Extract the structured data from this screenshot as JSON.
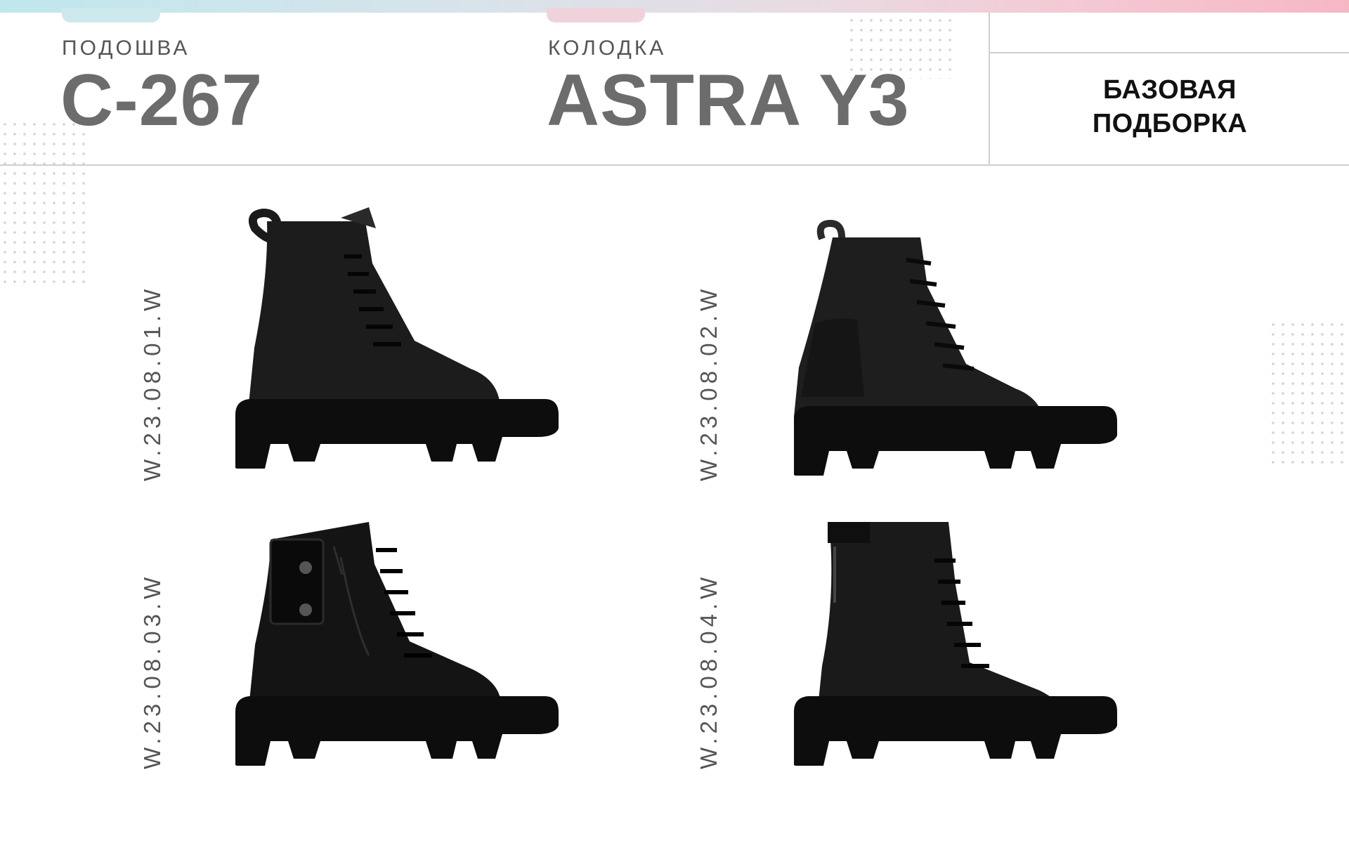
{
  "header": {
    "sole_label": "ПОДОШВА",
    "sole_value": "С-267",
    "last_label": "КОЛОДКА",
    "last_value": "ASTRA Y3",
    "collection_line1": "БАЗОВАЯ",
    "collection_line2": "ПОДБОРКА"
  },
  "products": [
    {
      "code": "W.23.08.01.W"
    },
    {
      "code": "W.23.08.02.W"
    },
    {
      "code": "W.23.08.03.W"
    },
    {
      "code": "W.23.08.04.W"
    }
  ],
  "colors": {
    "title_gray": "#6c6c6c",
    "accent_gradient_start": "#bfe7ee",
    "accent_gradient_end": "#f6b7c5",
    "boot_black": "#111111"
  }
}
